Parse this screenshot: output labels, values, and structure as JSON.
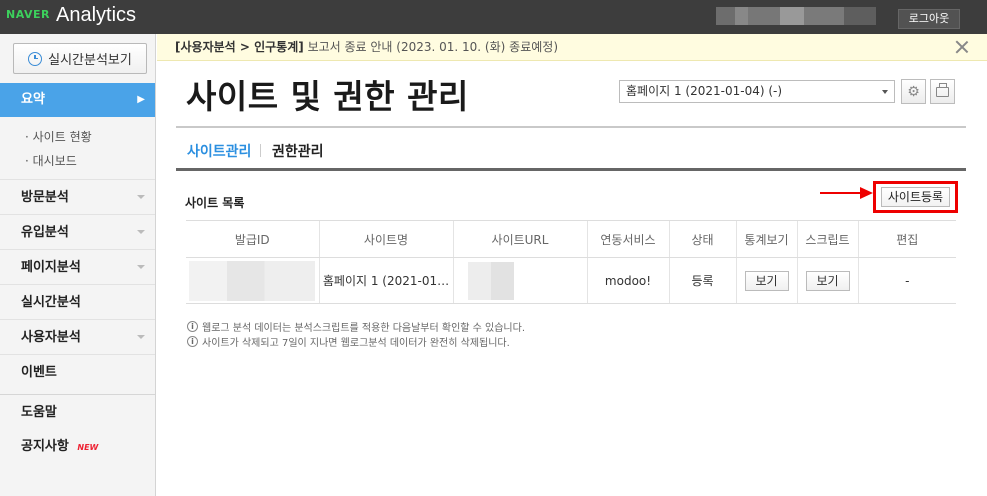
{
  "topbar": {
    "brand_naver": "NAVER",
    "brand_product": "Analytics",
    "logout_label": "로그아웃"
  },
  "sidebar": {
    "realtime_button": "실시간분석보기",
    "active_item": "요약",
    "sub_items": [
      "· 사이트 현황",
      "· 대시보드"
    ],
    "items": [
      {
        "label": "방문분석",
        "has_caret": true
      },
      {
        "label": "유입분석",
        "has_caret": true
      },
      {
        "label": "페이지분석",
        "has_caret": true
      },
      {
        "label": "실시간분석",
        "has_caret": false
      },
      {
        "label": "사용자분석",
        "has_caret": true
      },
      {
        "label": "이벤트",
        "has_caret": false
      },
      {
        "label": "도움말",
        "has_caret": false
      },
      {
        "label": "공지사항",
        "has_caret": false
      }
    ],
    "new_badge": "NEW"
  },
  "notice": {
    "category": "[사용자분석 > 인구통계]",
    "text": " 보고서 종료 안내 (2023. 01. 10. (화) 종료예정)"
  },
  "page": {
    "title": "사이트 및 권한 관리",
    "site_select_value": "홈페이지 1 (2021-01-04) (-)",
    "tabs": [
      "사이트관리",
      "권한관리"
    ],
    "section_title": "사이트 목록",
    "register_button": "사이트등록"
  },
  "table": {
    "headers": [
      "발급ID",
      "사이트명",
      "사이트URL",
      "연동서비스",
      "상태",
      "통계보기",
      "스크립트",
      "편집"
    ],
    "row": {
      "site_name": "홈페이지 1 (2021-01…",
      "service": "modoo!",
      "status": "등록",
      "stats_button": "보기",
      "script_button": "보기",
      "edit": "-"
    }
  },
  "info": [
    "웹로그 분석 데이터는 분석스크립트를 적용한 다음날부터 확인할 수 있습니다.",
    "사이트가 삭제되고 7일이 지나면 웹로그분석 데이터가 완전히 삭제됩니다."
  ],
  "colors": {
    "accent": "#4aa3e8",
    "highlight": "#ee0000",
    "brand_green": "#3cd05c"
  },
  "icons": [
    "clock-icon",
    "close-icon",
    "gear-icon",
    "print-icon",
    "info-icon",
    "arrow-icon"
  ]
}
